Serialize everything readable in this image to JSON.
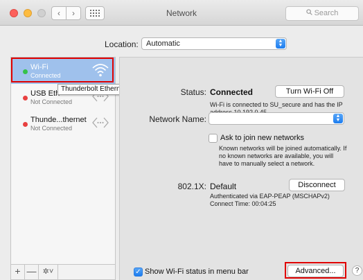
{
  "window": {
    "title": "Network"
  },
  "search": {
    "placeholder": "Search"
  },
  "location": {
    "label": "Location:",
    "value": "Automatic"
  },
  "services": [
    {
      "name": "Wi-Fi",
      "status": "Connected",
      "color": "#35c24a",
      "icon": "wifi-icon"
    },
    {
      "name": "USB Eth",
      "status": "Not Connected",
      "color": "#e84040",
      "icon": "ethernet-icon"
    },
    {
      "name": "Thunde...thernet",
      "status": "Not Connected",
      "color": "#e84040",
      "icon": "ethernet-icon"
    }
  ],
  "tooltip": "Thunderbolt Ethernet",
  "sidebar_controls": {
    "add": "+",
    "remove": "—",
    "gear": "✲˅"
  },
  "detail": {
    "status_label": "Status:",
    "status_value": "Connected",
    "turn_off_label": "Turn Wi-Fi Off",
    "status_note": "Wi-Fi is connected to SU_secure and has the IP address 10.192.0.45.",
    "network_name_label": "Network Name:",
    "network_name_value": "",
    "ask_label": "Ask to join new networks",
    "ask_note": "Known networks will be joined automatically. If no known networks are available, you will have to manually select a network.",
    "dot1x_label": "802.1X:",
    "dot1x_value": "Default",
    "disconnect_label": "Disconnect",
    "dot1x_note1": "Authenticated via EAP-PEAP (MSCHAPv2)",
    "dot1x_note2": "Connect Time: 00:04:25",
    "show_wifi_label": "Show Wi-Fi status in menu bar",
    "advanced_label": "Advanced...",
    "help_label": "?"
  },
  "colors": {
    "accent": "#1c7cef",
    "selection": "#9fc1ec",
    "highlight_box": "#e00000"
  }
}
